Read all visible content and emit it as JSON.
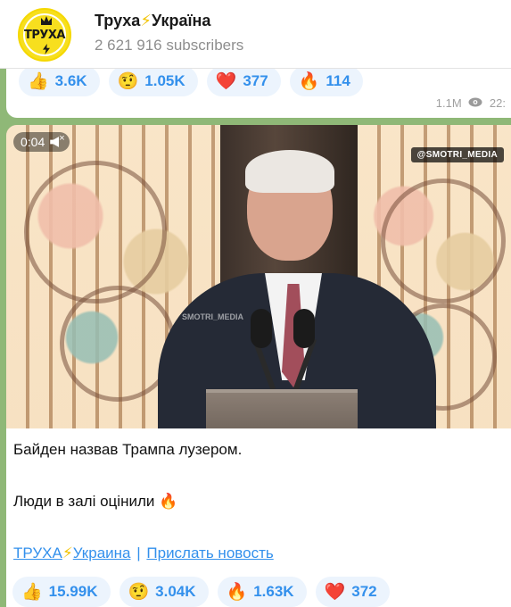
{
  "channel": {
    "name": "Труха⚡Україна",
    "name_parts": [
      "Труха",
      "⚡",
      "Україна"
    ],
    "subscribers": "2 621 916 subscribers",
    "logo_text": "ТРУХА"
  },
  "previous_post": {
    "reactions": [
      {
        "emoji": "👍",
        "count": "3.6K"
      },
      {
        "emoji": "🤨",
        "count": "1.05K"
      },
      {
        "emoji": "❤️",
        "count": "377"
      },
      {
        "emoji": "🔥",
        "count": "114"
      }
    ],
    "views": "1.1M",
    "time": "22:"
  },
  "post": {
    "video": {
      "duration": "0:04",
      "watermark": "@SMOTRI_MEDIA",
      "watermark_small": "SMOTRI_MEDIA"
    },
    "caption_line1": "Байден назвав Трампа лузером.",
    "caption_line2": "Люди в залі оцінили",
    "caption_emoji": "🔥",
    "links": {
      "channel_link_a": "ТРУХА",
      "bolt": "⚡",
      "channel_link_b": "Украина",
      "separator": "|",
      "submit_news": "Прислать новость"
    },
    "reactions": [
      {
        "emoji": "👍",
        "count": "15.99K"
      },
      {
        "emoji": "🤨",
        "count": "3.04K"
      },
      {
        "emoji": "🔥",
        "count": "1.63K"
      },
      {
        "emoji": "❤️",
        "count": "372"
      }
    ]
  },
  "colors": {
    "background": "#8fb877",
    "accent": "#3390ec",
    "chip": "#ecf4fd",
    "logo": "#f7df1e"
  },
  "icons": [
    "eye-icon",
    "speaker-muted-icon",
    "lightning-icon"
  ]
}
